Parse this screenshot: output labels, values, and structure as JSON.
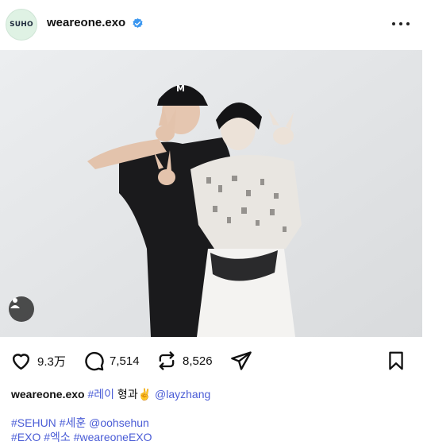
{
  "account": {
    "avatar_text": "SUHO",
    "username": "weareone.exo",
    "verified_icon": "verified-badge-icon"
  },
  "post": {
    "more_icon": "more-options-icon",
    "tag_icon": "user-tag-icon"
  },
  "actions": {
    "like_count": "9.3万",
    "comment_count": "7,514",
    "repost_count": "8,526"
  },
  "caption": {
    "username": "weareone.exo",
    "hashtag_1": "#레이",
    "text": " 형과✌️ ",
    "mention": "@layzhang"
  },
  "tags": {
    "line1": [
      {
        "text": "#SEHUN"
      },
      {
        "text": "#세훈"
      },
      {
        "text": "@oohsehun"
      }
    ],
    "line2": [
      {
        "text": "#EXO"
      },
      {
        "text": "#엑소"
      },
      {
        "text": "#weareoneEXO"
      }
    ]
  },
  "colors": {
    "link": "#4a5cd6",
    "verified": "#3b97f0",
    "photo_bg": "#e2e3e5"
  }
}
